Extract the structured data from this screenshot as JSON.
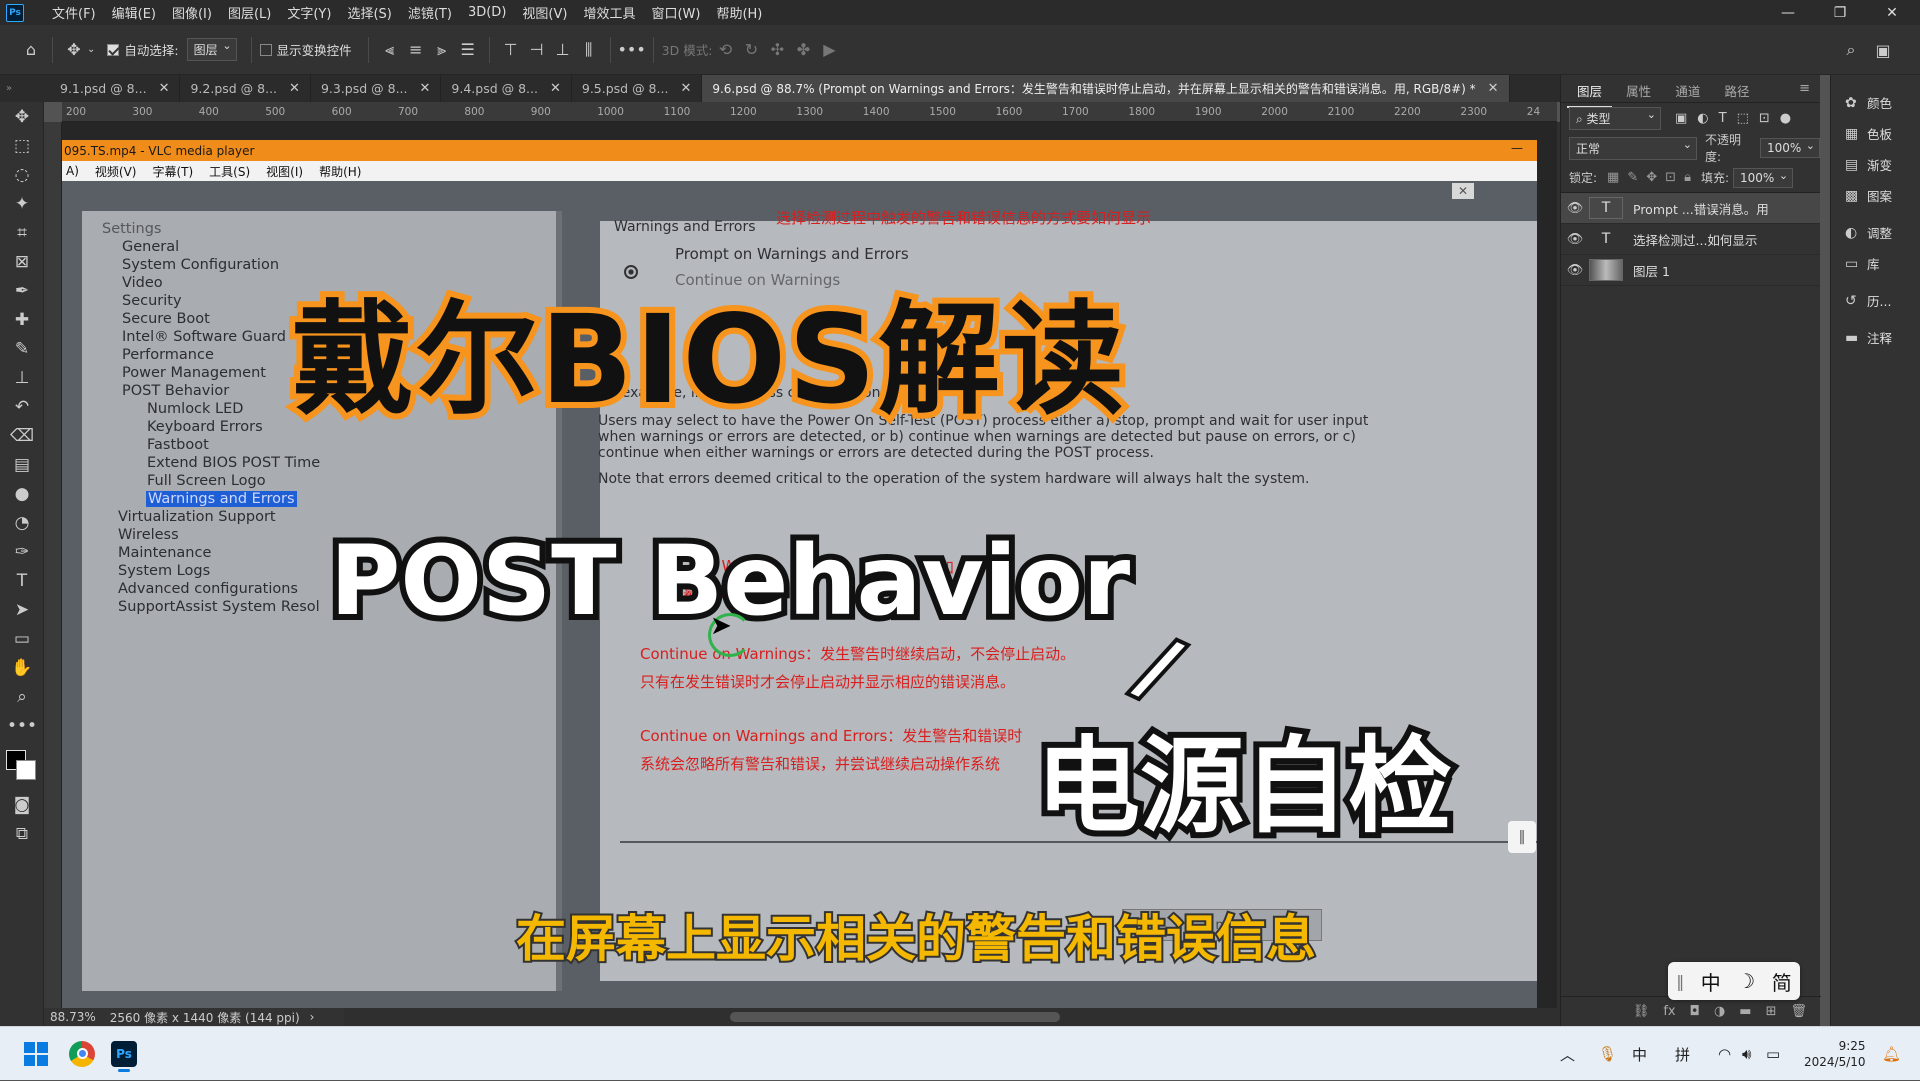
{
  "menubar": {
    "logo": "Ps",
    "items": [
      "文件(F)",
      "编辑(E)",
      "图像(I)",
      "图层(L)",
      "文字(Y)",
      "选择(S)",
      "滤镜(T)",
      "3D(D)",
      "视图(V)",
      "增效工具",
      "窗口(W)",
      "帮助(H)"
    ]
  },
  "options": {
    "auto_select_label": "自动选择:",
    "layer_select": "图层",
    "show_transform_label": "显示变换控件",
    "mode_3d_label": "3D 模式:"
  },
  "tabs": [
    {
      "label": "9.1.psd @ 8..."
    },
    {
      "label": "9.2.psd @ 8..."
    },
    {
      "label": "9.3.psd @ 8..."
    },
    {
      "label": "9.4.psd @ 8..."
    },
    {
      "label": "9.5.psd @ 8..."
    },
    {
      "label": "9.6.psd @ 88.7% (Prompt on Warnings and Errors：发生警告和错误时停止启动，并在屏幕上显示相关的警告和错误消息。用, RGB/8#) *"
    }
  ],
  "ruler": {
    "h_ticks": [
      "200",
      "300",
      "400",
      "500",
      "600",
      "700",
      "800",
      "900",
      "1000",
      "1100",
      "1200",
      "1300",
      "1400",
      "1500",
      "1600",
      "1700",
      "1800",
      "1900",
      "2000",
      "2100",
      "2200",
      "2300",
      "24"
    ]
  },
  "vlc": {
    "title": "095.TS.mp4 - VLC media player",
    "menu": [
      "A)",
      "视频(V)",
      "字幕(T)",
      "工具(S)",
      "视图(I)",
      "帮助(H)"
    ]
  },
  "bios": {
    "settings_label": "Settings",
    "tree": [
      "General",
      "System Configuration",
      "Video",
      "Security",
      "Secure Boot",
      "Intel® Software Guard",
      "Performance",
      "Power Management",
      "POST Behavior",
      "Numlock LED",
      "Keyboard Errors",
      "Fastboot",
      "Extend BIOS POST Time",
      "Full Screen Logo",
      "Warnings and Errors",
      "Virtualization Support",
      "Wireless",
      "Maintenance",
      "System Logs",
      "Advanced configurations",
      "SupportAssist System Resol"
    ],
    "section_title": "Warnings and Errors",
    "radio1": "Prompt on Warnings and Errors",
    "radio2": "Continue on Warnings",
    "para1_line1": "for example, in a headless configuration.",
    "para2_line1": "Users may select to have the Power On Self-Test (POST) process either a) stop, prompt and wait for user input",
    "para2_line2": "when warnings or errors are detected, or b) continue when warnings are detected but pause on errors, or c)",
    "para2_line3": "continue when either warnings or errors are detected during the POST process.",
    "para3": "Note that errors deemed critical to the operation of the system hardware will always halt the system.",
    "button_label": "nt"
  },
  "annotations": {
    "top_red": "选择检测过程中触发的警告和错误信息的方式要如何显示",
    "red1_a": "on W",
    "red1_b": "告和",
    "red2": "屏幕上显",
    "red3": "Continue on Warnings：发生警告时继续启动，不会停止启动。",
    "red4": "只有在发生错误时才会停止启动并显示相应的错误消息。",
    "red5": "Continue on Warnings and Errors：发生警告和错误时",
    "red6": "系统会忽略所有警告和错误，并尝试继续启动操作系统"
  },
  "titles": {
    "main": "戴尔BIOS解读",
    "sub": "POST Behavior",
    "slash": "/",
    "cn": "电源自检",
    "caption": "在屏幕上显示相关的警告和错误信息"
  },
  "status": {
    "zoom": "88.73%",
    "size": "2560 像素 x 1440 像素 (144 ppi)"
  },
  "layers_panel": {
    "tabs": [
      "图层",
      "属性",
      "通道",
      "路径"
    ],
    "filter": "类型",
    "blend": "正常",
    "opacity_label": "不透明度:",
    "opacity": "100%",
    "lock_label": "锁定:",
    "fill_label": "填充:",
    "fill": "100%",
    "layers": [
      {
        "name": "Prompt ...错误消息。用",
        "type": "T"
      },
      {
        "name": "选择检测过...如何显示",
        "type": "T"
      },
      {
        "name": "图层 1",
        "type": "image"
      }
    ]
  },
  "side_panel": {
    "items": [
      {
        "label": "颜色",
        "icon": "palette-icon"
      },
      {
        "label": "色板",
        "icon": "grid-icon"
      },
      {
        "label": "渐变",
        "icon": "gradient-icon"
      },
      {
        "label": "图案",
        "icon": "pattern-icon"
      },
      {
        "label": "调整",
        "icon": "adjust-icon"
      },
      {
        "label": "库",
        "icon": "library-icon"
      },
      {
        "label": "历...",
        "icon": "history-icon"
      },
      {
        "label": "注释",
        "icon": "comment-icon"
      }
    ]
  },
  "ime": {
    "mode": "中",
    "punct": "☽",
    "script": "简"
  },
  "taskbar": {
    "tray_lang": "中",
    "tray_pinyin": "拼",
    "time": "9:25",
    "date": "2024/5/10"
  },
  "colors": {
    "vlc_orange": "#f08c1a",
    "annotation_red": "#d91e1e",
    "title_orange": "#f7941d",
    "caption_yellow": "#f5b800"
  }
}
